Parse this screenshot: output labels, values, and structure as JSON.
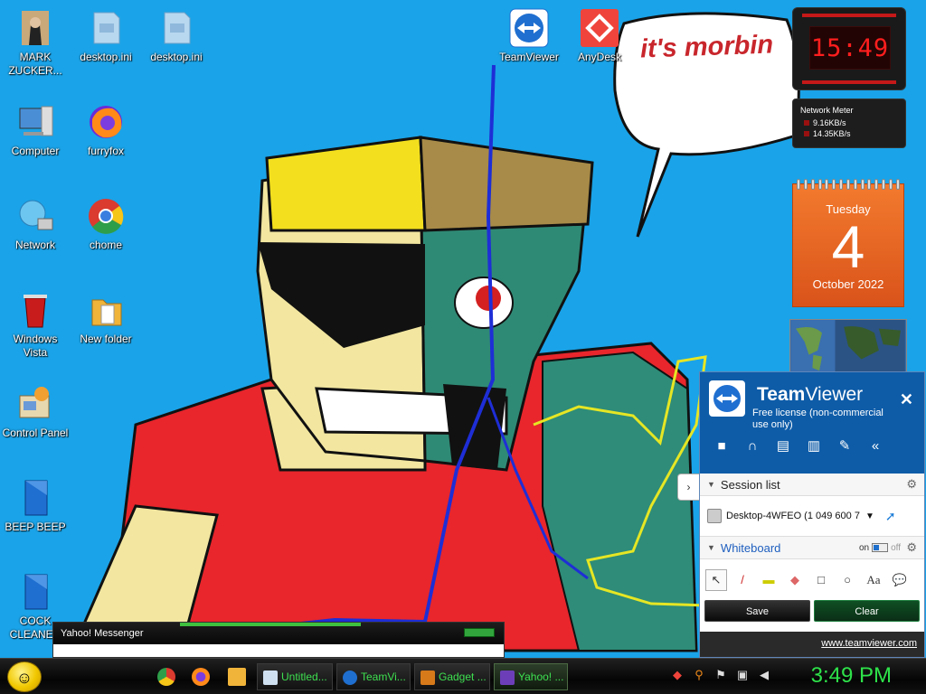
{
  "desktop": {
    "icons": [
      {
        "label": "MARK ZUCKER...",
        "icon": "person-photo-icon"
      },
      {
        "label": "desktop.ini",
        "icon": "config-file-icon"
      },
      {
        "label": "desktop.ini",
        "icon": "config-file-icon"
      },
      {
        "label": "Computer",
        "icon": "computer-icon"
      },
      {
        "label": "furryfox",
        "icon": "firefox-icon"
      },
      {
        "label": "Network",
        "icon": "network-globe-icon"
      },
      {
        "label": "chome",
        "icon": "chrome-icon"
      },
      {
        "label": "Windows Vista",
        "icon": "recycle-bin-icon"
      },
      {
        "label": "New folder",
        "icon": "folder-icon"
      },
      {
        "label": "Control Panel",
        "icon": "control-panel-icon"
      },
      {
        "label": "BEEP BEEP",
        "icon": "blue-file-icon"
      },
      {
        "label": "COCK CLEANER",
        "icon": "blue-file-icon"
      },
      {
        "label": "TeamViewer",
        "icon": "teamviewer-icon"
      },
      {
        "label": "AnyDesk",
        "icon": "anydesk-icon"
      }
    ],
    "speech_bubble": "it's morbin"
  },
  "gadgets": {
    "clock_time": "15:49",
    "network": {
      "title": "Network Meter",
      "down": "9.16KB/s",
      "up": "14.35KB/s"
    },
    "calendar": {
      "weekday": "Tuesday",
      "day": "4",
      "month_year": "October 2022"
    }
  },
  "teamviewer": {
    "brand_bold": "Team",
    "brand_light": "Viewer",
    "license": "Free license (non-commercial use only)",
    "session_list": "Session list",
    "session_item": "Desktop-4WFEO (1 049 600 7",
    "whiteboard": "Whiteboard",
    "toggle_on": "on",
    "toggle_off": "off",
    "save": "Save",
    "clear": "Clear",
    "url": "www.teamviewer.com"
  },
  "yahoo_window": {
    "title": "Yahoo! Messenger"
  },
  "taskbar": {
    "tasks": [
      {
        "label": "Untitled...",
        "icon": "notepad-icon"
      },
      {
        "label": "TeamVi...",
        "icon": "teamviewer-icon"
      },
      {
        "label": "Gadget ...",
        "icon": "gadget-icon"
      },
      {
        "label": "Yahoo! ...",
        "icon": "yahoo-icon"
      }
    ],
    "time": "3:49 PM"
  },
  "colors": {
    "accent_green": "#2ee24a",
    "tv_blue": "#0e5ca8",
    "desktop_blue": "#1aa3e8"
  }
}
